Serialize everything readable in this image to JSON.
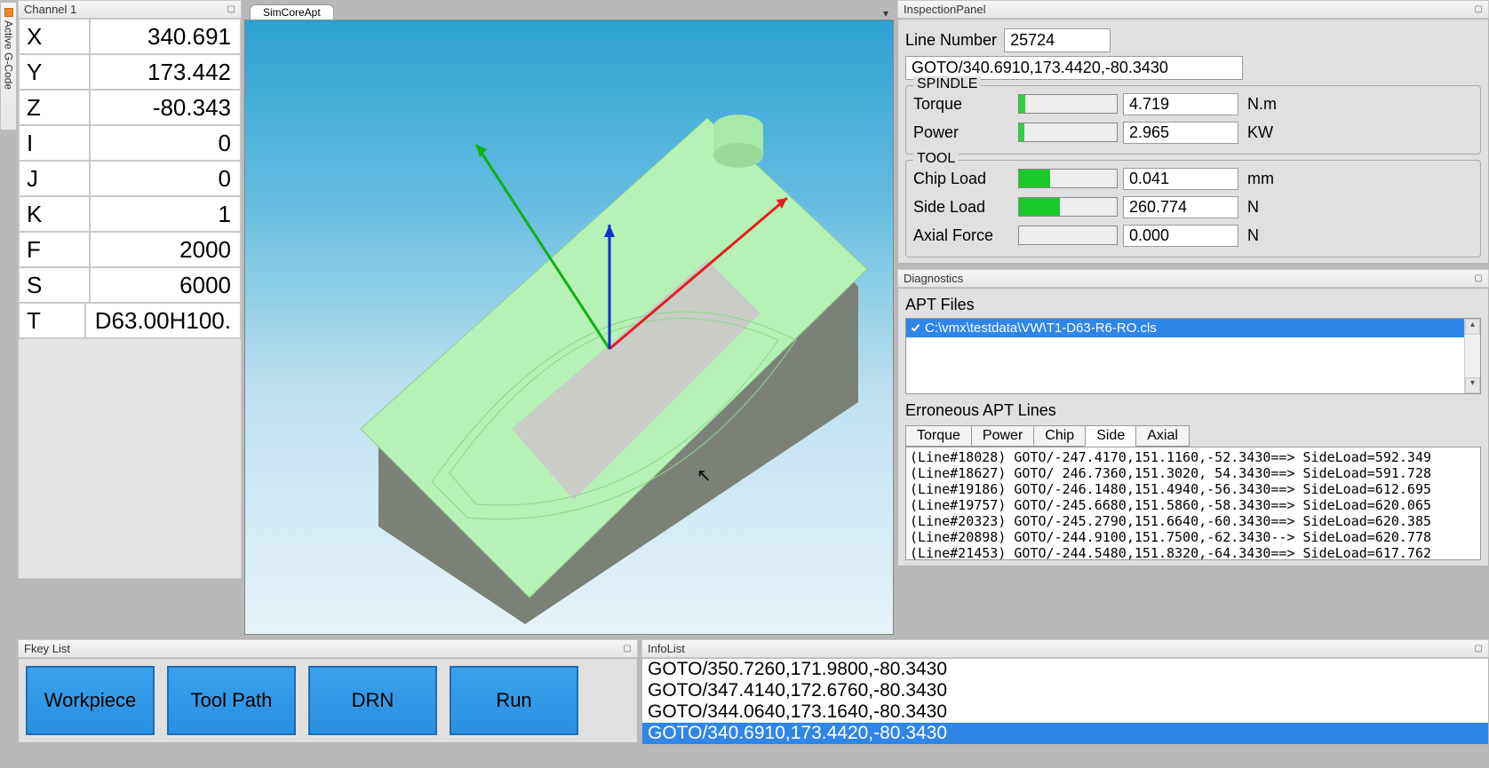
{
  "sidebar_tab": "Active G-Code",
  "channel": {
    "title": "Channel 1",
    "rows": [
      {
        "label": "X",
        "value": "340.691"
      },
      {
        "label": "Y",
        "value": "173.442"
      },
      {
        "label": "Z",
        "value": "-80.343"
      },
      {
        "label": "I",
        "value": "0"
      },
      {
        "label": "J",
        "value": "0"
      },
      {
        "label": "K",
        "value": "1"
      },
      {
        "label": "F",
        "value": "2000"
      },
      {
        "label": "S",
        "value": "6000"
      },
      {
        "label": "T",
        "value": "D63.00H100."
      }
    ]
  },
  "viewport": {
    "tab": "SimCoreApt"
  },
  "inspection": {
    "title": "InspectionPanel",
    "line_number_label": "Line Number",
    "line_number": "25724",
    "gcode": "GOTO/340.6910,173.4420,-80.3430",
    "spindle": {
      "title": "SPINDLE",
      "rows": [
        {
          "label": "Torque",
          "value": "4.719",
          "unit": "N.m",
          "fill": 6,
          "color": "#2bd43a"
        },
        {
          "label": "Power",
          "value": "2.965",
          "unit": "KW",
          "fill": 5,
          "color": "#2bd43a"
        }
      ]
    },
    "tool": {
      "title": "TOOL",
      "rows": [
        {
          "label": "Chip Load",
          "value": "0.041",
          "unit": "mm",
          "fill": 32,
          "color": "#19c92a"
        },
        {
          "label": "Side Load",
          "value": "260.774",
          "unit": "N",
          "fill": 42,
          "color": "#19c92a"
        },
        {
          "label": "Axial Force",
          "value": "0.000",
          "unit": "N",
          "fill": 0,
          "color": "#19c92a"
        }
      ]
    }
  },
  "diagnostics": {
    "title": "Diagnostics",
    "apt_label": "APT Files",
    "apt_file": "C:\\vmx\\testdata\\VW\\T1-D63-R6-RO.cls",
    "err_label": "Erroneous APT Lines",
    "tabs": [
      "Torque",
      "Power",
      "Chip",
      "Side",
      "Axial"
    ],
    "active_tab": 3,
    "lines": [
      "(Line#18028) GOTO/-247.4170,151.1160,-52.3430==> SideLoad=592.349",
      "(Line#18627) GOTO/ 246.7360,151.3020, 54.3430==> SideLoad=591.728",
      "(Line#19186) GOTO/-246.1480,151.4940,-56.3430==> SideLoad=612.695",
      "(Line#19757) GOTO/-245.6680,151.5860,-58.3430==> SideLoad=620.065",
      "(Line#20323) GOTO/-245.2790,151.6640,-60.3430==> SideLoad=620.385",
      "(Line#20898) GOTO/-244.9100,151.7500,-62.3430--> SideLoad=620.778",
      "(Line#21453) GOTO/-244.5480,151.8320,-64.3430==> SideLoad=617.762"
    ]
  },
  "fkeys": {
    "title": "Fkey List",
    "buttons": [
      "Workpiece",
      "Tool Path",
      "DRN",
      "Run"
    ]
  },
  "info": {
    "title": "InfoList",
    "lines": [
      "GOTO/350.7260,171.9800,-80.3430",
      "GOTO/347.4140,172.6760,-80.3430",
      "GOTO/344.0640,173.1640,-80.3430",
      "GOTO/340.6910,173.4420,-80.3430"
    ],
    "selected": 3
  }
}
